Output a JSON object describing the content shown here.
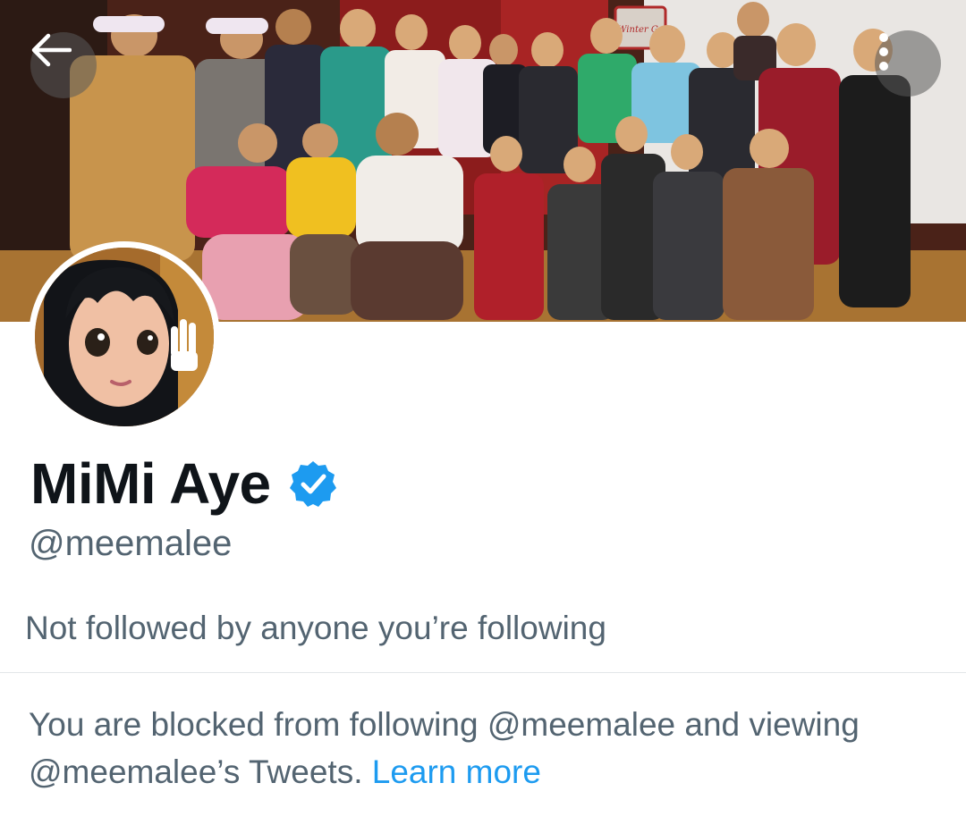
{
  "profile": {
    "display_name": "MiMi Aye",
    "verified": true,
    "handle": "@meemalee",
    "followers_note": "Not followed by anyone you’re following"
  },
  "blocked": {
    "line1": "You are blocked from following @meemalee and viewing",
    "line2": "@meemalee’s Tweets.",
    "learn_more": "Learn more"
  },
  "banner": {
    "sign_text": "Winter Ga"
  },
  "icons": {
    "back": "arrow-left-icon",
    "more": "more-vertical-icon",
    "verified": "verified-badge-icon"
  },
  "colors": {
    "link": "#1d9bf0",
    "secondary_text": "#536471",
    "primary_text": "#0f1419",
    "verified_badge": "#1d9bf0"
  }
}
